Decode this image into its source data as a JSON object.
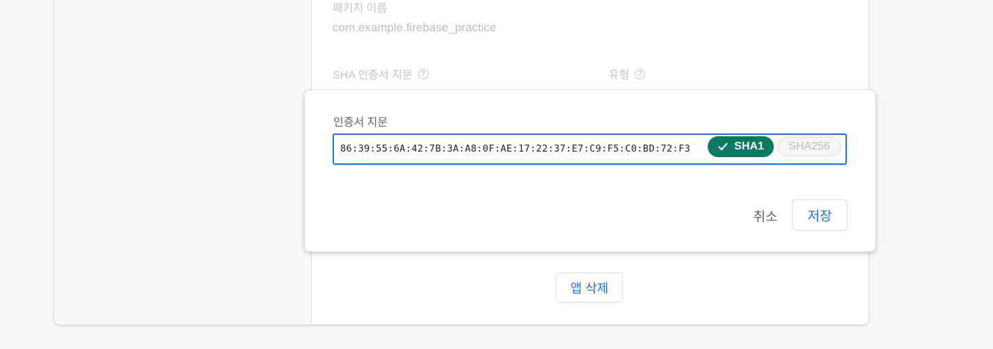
{
  "app_settings": {
    "package_name_label": "패키지 이름",
    "package_name_value": "com.example.firebase_practice",
    "sha_column_label": "SHA 인증서 지문",
    "type_column_label": "유형",
    "help_glyph": "?",
    "delete_app_label": "앱 삭제"
  },
  "dialog": {
    "fingerprint_label": "인증서 지문",
    "fingerprint_value": "86:39:55:6A:42:7B:3A:A8:0F:AE:17:22:37:E7:C9:F5:C0:BD:72:F3",
    "chips": {
      "sha1_label": "SHA1",
      "sha256_label": "SHA256",
      "selected": "SHA1"
    },
    "cancel_label": "취소",
    "save_label": "저장"
  },
  "colors": {
    "accent": "#1a73e8",
    "chip_selected": "#0b7a62"
  }
}
